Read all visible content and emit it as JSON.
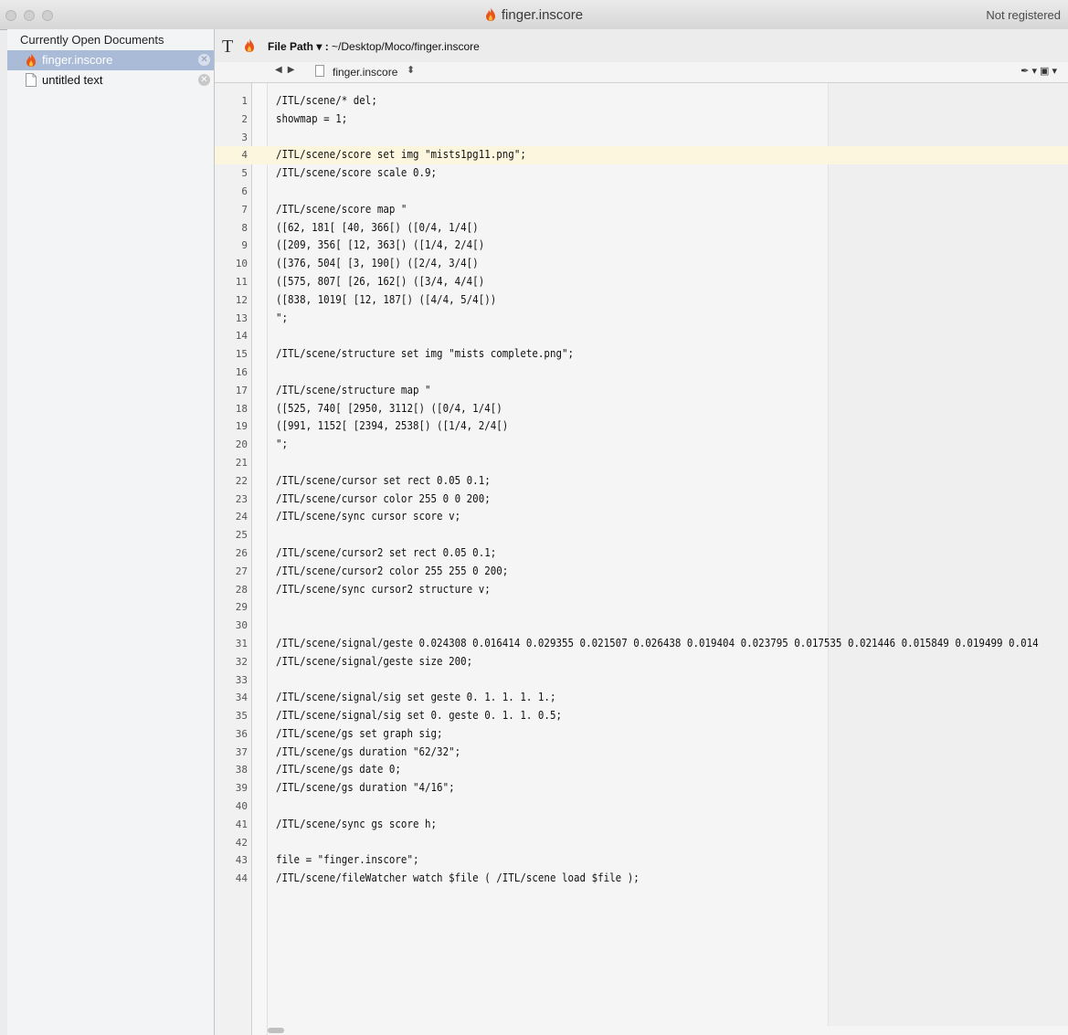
{
  "window": {
    "title": "finger.inscore",
    "registration": "Not registered"
  },
  "sidebar": {
    "header": "Currently Open Documents",
    "documents": [
      {
        "name": "finger.inscore",
        "icon": "inscore-flame-icon"
      },
      {
        "name": "untitled text",
        "icon": "document-icon"
      }
    ]
  },
  "toolbar": {
    "text_button": "T",
    "path_label": "File Path ▾ :",
    "path_value": "~/Desktop/Moco/finger.inscore"
  },
  "navbar": {
    "filename": "finger.inscore"
  },
  "editor": {
    "current_line": 4,
    "lines": [
      "/ITL/scene/* del;",
      "showmap = 1;",
      "",
      "/ITL/scene/score set img \"mists1pg11.png\";",
      "/ITL/scene/score scale 0.9;",
      "",
      "/ITL/scene/score map \"",
      "([62, 181[ [40, 366[) ([0/4, 1/4[)",
      "([209, 356[ [12, 363[) ([1/4, 2/4[)",
      "([376, 504[ [3, 190[) ([2/4, 3/4[)",
      "([575, 807[ [26, 162[) ([3/4, 4/4[)",
      "([838, 1019[ [12, 187[) ([4/4, 5/4[))",
      "\";",
      "",
      "/ITL/scene/structure set img \"mists complete.png\";",
      "",
      "/ITL/scene/structure map \"",
      "([525, 740[ [2950, 3112[) ([0/4, 1/4[)",
      "([991, 1152[ [2394, 2538[) ([1/4, 2/4[)",
      "\";",
      "",
      "/ITL/scene/cursor set rect 0.05 0.1;",
      "/ITL/scene/cursor color 255 0 0 200;",
      "/ITL/scene/sync cursor score v;",
      "",
      "/ITL/scene/cursor2 set rect 0.05 0.1;",
      "/ITL/scene/cursor2 color 255 255 0 200;",
      "/ITL/scene/sync cursor2 structure v;",
      "",
      "",
      "/ITL/scene/signal/geste 0.024308 0.016414 0.029355 0.021507 0.026438 0.019404 0.023795 0.017535 0.021446 0.015849 0.019499 0.014",
      "/ITL/scene/signal/geste size 200;",
      "",
      "/ITL/scene/signal/sig set geste 0. 1. 1. 1. 1.;",
      "/ITL/scene/signal/sig set 0. geste 0. 1. 1. 0.5;",
      "/ITL/scene/gs set graph sig;",
      "/ITL/scene/gs duration \"62/32\";",
      "/ITL/scene/gs date 0;",
      "/ITL/scene/gs duration \"4/16\";",
      "",
      "/ITL/scene/sync gs score h;",
      "",
      "file = \"finger.inscore\";",
      "/ITL/scene/fileWatcher watch $file ( /ITL/scene load $file );"
    ]
  }
}
